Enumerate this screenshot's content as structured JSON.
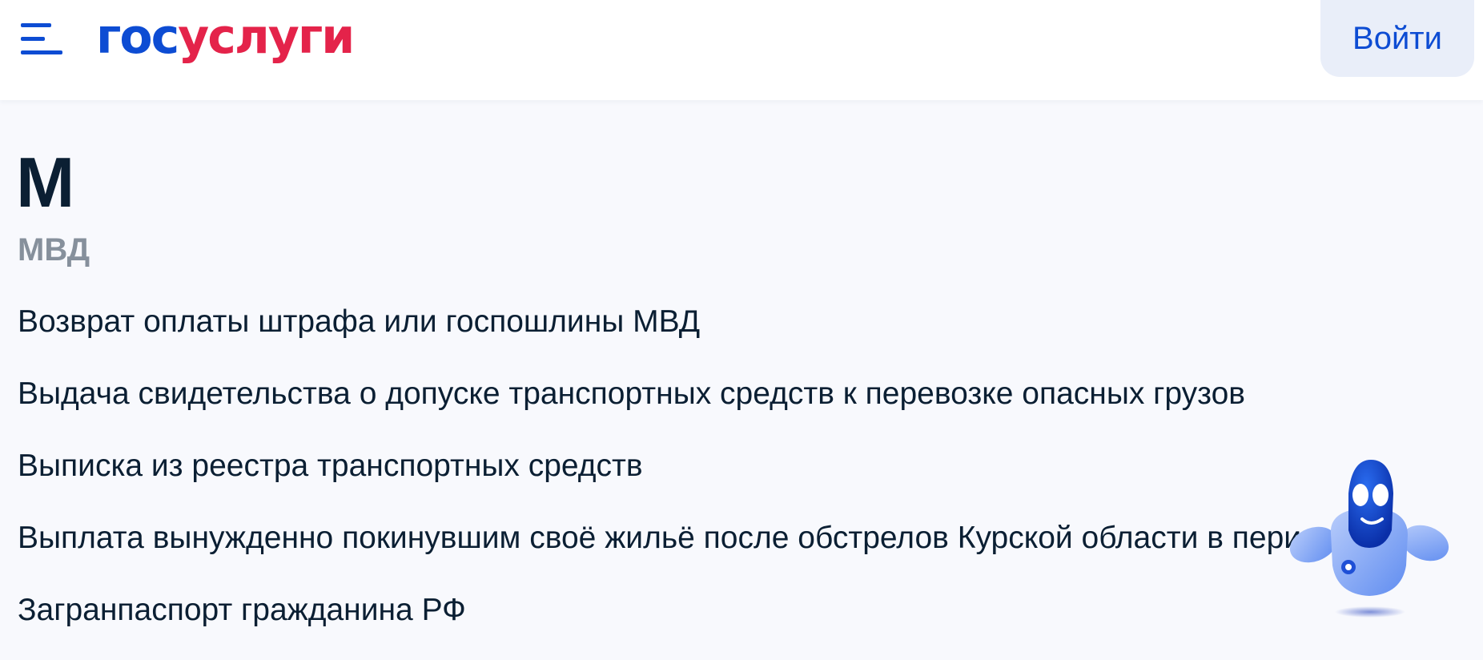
{
  "header": {
    "logo_part1": "гос",
    "logo_part2": "услуги",
    "login_label": "Войти"
  },
  "main": {
    "letter": "М",
    "department": "МВД",
    "services": [
      "Возврат оплаты штрафа или госпошлины МВД",
      "Выдача свидетельства о допуске транспортных средств к перевозке опасных грузов",
      "Выписка из реестра транспортных средств",
      "Выплата вынужденно покинувшим своё жильё после обстрелов Курской области в период СВО",
      "Загранпаспорт гражданина РФ"
    ]
  },
  "colors": {
    "brand_blue": "#0d4cd3",
    "brand_red": "#e4234a",
    "text": "#0b1f33",
    "muted": "#86909c",
    "background": "#f8f9fd"
  },
  "icons": {
    "menu": "menu-icon",
    "assistant": "robot-assistant-icon"
  }
}
